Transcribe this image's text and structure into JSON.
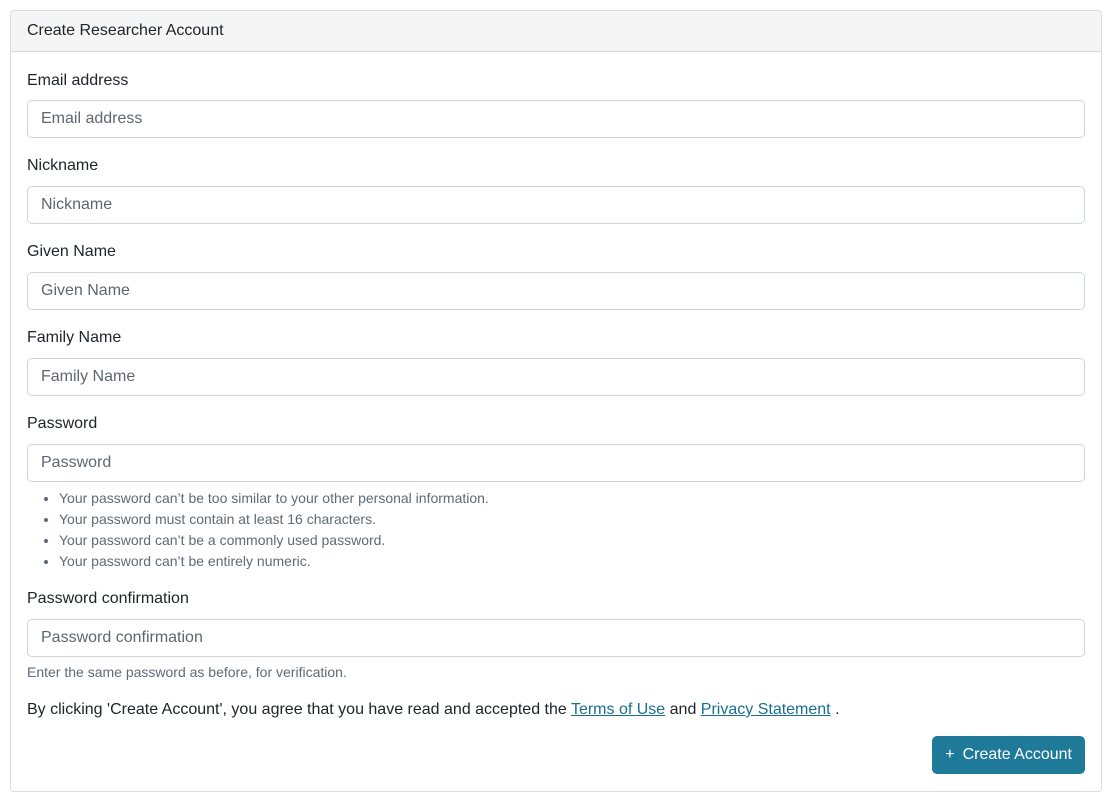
{
  "card": {
    "title": "Create Researcher Account"
  },
  "form": {
    "email": {
      "label": "Email address",
      "placeholder": "Email address"
    },
    "nickname": {
      "label": "Nickname",
      "placeholder": "Nickname"
    },
    "given_name": {
      "label": "Given Name",
      "placeholder": "Given Name"
    },
    "family_name": {
      "label": "Family Name",
      "placeholder": "Family Name"
    },
    "password": {
      "label": "Password",
      "placeholder": "Password",
      "help": [
        "Your password can’t be too similar to your other personal information.",
        "Your password must contain at least 16 characters.",
        "Your password can’t be a commonly used password.",
        "Your password can’t be entirely numeric."
      ]
    },
    "password_confirmation": {
      "label": "Password confirmation",
      "placeholder": "Password confirmation",
      "help": "Enter the same password as before, for verification."
    }
  },
  "agreement": {
    "prefix": "By clicking 'Create Account', you agree that you have read and accepted the",
    "terms_link": "Terms of Use",
    "middle": "and",
    "privacy_link": "Privacy Statement",
    "suffix": "."
  },
  "submit": {
    "icon": "plus-icon",
    "label": "Create Account"
  },
  "colors": {
    "primary": "#1f7a99",
    "link": "#1a6e8e"
  }
}
